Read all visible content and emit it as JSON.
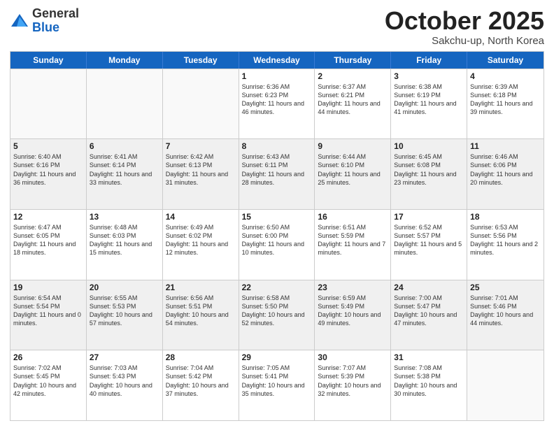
{
  "header": {
    "logo_general": "General",
    "logo_blue": "Blue",
    "month_title": "October 2025",
    "location": "Sakchu-up, North Korea"
  },
  "days_of_week": [
    "Sunday",
    "Monday",
    "Tuesday",
    "Wednesday",
    "Thursday",
    "Friday",
    "Saturday"
  ],
  "weeks": [
    [
      {
        "day": "",
        "sunrise": "",
        "sunset": "",
        "daylight": "",
        "empty": true
      },
      {
        "day": "",
        "sunrise": "",
        "sunset": "",
        "daylight": "",
        "empty": true
      },
      {
        "day": "",
        "sunrise": "",
        "sunset": "",
        "daylight": "",
        "empty": true
      },
      {
        "day": "1",
        "sunrise": "Sunrise: 6:36 AM",
        "sunset": "Sunset: 6:23 PM",
        "daylight": "Daylight: 11 hours and 46 minutes."
      },
      {
        "day": "2",
        "sunrise": "Sunrise: 6:37 AM",
        "sunset": "Sunset: 6:21 PM",
        "daylight": "Daylight: 11 hours and 44 minutes."
      },
      {
        "day": "3",
        "sunrise": "Sunrise: 6:38 AM",
        "sunset": "Sunset: 6:19 PM",
        "daylight": "Daylight: 11 hours and 41 minutes."
      },
      {
        "day": "4",
        "sunrise": "Sunrise: 6:39 AM",
        "sunset": "Sunset: 6:18 PM",
        "daylight": "Daylight: 11 hours and 39 minutes."
      }
    ],
    [
      {
        "day": "5",
        "sunrise": "Sunrise: 6:40 AM",
        "sunset": "Sunset: 6:16 PM",
        "daylight": "Daylight: 11 hours and 36 minutes."
      },
      {
        "day": "6",
        "sunrise": "Sunrise: 6:41 AM",
        "sunset": "Sunset: 6:14 PM",
        "daylight": "Daylight: 11 hours and 33 minutes."
      },
      {
        "day": "7",
        "sunrise": "Sunrise: 6:42 AM",
        "sunset": "Sunset: 6:13 PM",
        "daylight": "Daylight: 11 hours and 31 minutes."
      },
      {
        "day": "8",
        "sunrise": "Sunrise: 6:43 AM",
        "sunset": "Sunset: 6:11 PM",
        "daylight": "Daylight: 11 hours and 28 minutes."
      },
      {
        "day": "9",
        "sunrise": "Sunrise: 6:44 AM",
        "sunset": "Sunset: 6:10 PM",
        "daylight": "Daylight: 11 hours and 25 minutes."
      },
      {
        "day": "10",
        "sunrise": "Sunrise: 6:45 AM",
        "sunset": "Sunset: 6:08 PM",
        "daylight": "Daylight: 11 hours and 23 minutes."
      },
      {
        "day": "11",
        "sunrise": "Sunrise: 6:46 AM",
        "sunset": "Sunset: 6:06 PM",
        "daylight": "Daylight: 11 hours and 20 minutes."
      }
    ],
    [
      {
        "day": "12",
        "sunrise": "Sunrise: 6:47 AM",
        "sunset": "Sunset: 6:05 PM",
        "daylight": "Daylight: 11 hours and 18 minutes."
      },
      {
        "day": "13",
        "sunrise": "Sunrise: 6:48 AM",
        "sunset": "Sunset: 6:03 PM",
        "daylight": "Daylight: 11 hours and 15 minutes."
      },
      {
        "day": "14",
        "sunrise": "Sunrise: 6:49 AM",
        "sunset": "Sunset: 6:02 PM",
        "daylight": "Daylight: 11 hours and 12 minutes."
      },
      {
        "day": "15",
        "sunrise": "Sunrise: 6:50 AM",
        "sunset": "Sunset: 6:00 PM",
        "daylight": "Daylight: 11 hours and 10 minutes."
      },
      {
        "day": "16",
        "sunrise": "Sunrise: 6:51 AM",
        "sunset": "Sunset: 5:59 PM",
        "daylight": "Daylight: 11 hours and 7 minutes."
      },
      {
        "day": "17",
        "sunrise": "Sunrise: 6:52 AM",
        "sunset": "Sunset: 5:57 PM",
        "daylight": "Daylight: 11 hours and 5 minutes."
      },
      {
        "day": "18",
        "sunrise": "Sunrise: 6:53 AM",
        "sunset": "Sunset: 5:56 PM",
        "daylight": "Daylight: 11 hours and 2 minutes."
      }
    ],
    [
      {
        "day": "19",
        "sunrise": "Sunrise: 6:54 AM",
        "sunset": "Sunset: 5:54 PM",
        "daylight": "Daylight: 11 hours and 0 minutes."
      },
      {
        "day": "20",
        "sunrise": "Sunrise: 6:55 AM",
        "sunset": "Sunset: 5:53 PM",
        "daylight": "Daylight: 10 hours and 57 minutes."
      },
      {
        "day": "21",
        "sunrise": "Sunrise: 6:56 AM",
        "sunset": "Sunset: 5:51 PM",
        "daylight": "Daylight: 10 hours and 54 minutes."
      },
      {
        "day": "22",
        "sunrise": "Sunrise: 6:58 AM",
        "sunset": "Sunset: 5:50 PM",
        "daylight": "Daylight: 10 hours and 52 minutes."
      },
      {
        "day": "23",
        "sunrise": "Sunrise: 6:59 AM",
        "sunset": "Sunset: 5:49 PM",
        "daylight": "Daylight: 10 hours and 49 minutes."
      },
      {
        "day": "24",
        "sunrise": "Sunrise: 7:00 AM",
        "sunset": "Sunset: 5:47 PM",
        "daylight": "Daylight: 10 hours and 47 minutes."
      },
      {
        "day": "25",
        "sunrise": "Sunrise: 7:01 AM",
        "sunset": "Sunset: 5:46 PM",
        "daylight": "Daylight: 10 hours and 44 minutes."
      }
    ],
    [
      {
        "day": "26",
        "sunrise": "Sunrise: 7:02 AM",
        "sunset": "Sunset: 5:45 PM",
        "daylight": "Daylight: 10 hours and 42 minutes."
      },
      {
        "day": "27",
        "sunrise": "Sunrise: 7:03 AM",
        "sunset": "Sunset: 5:43 PM",
        "daylight": "Daylight: 10 hours and 40 minutes."
      },
      {
        "day": "28",
        "sunrise": "Sunrise: 7:04 AM",
        "sunset": "Sunset: 5:42 PM",
        "daylight": "Daylight: 10 hours and 37 minutes."
      },
      {
        "day": "29",
        "sunrise": "Sunrise: 7:05 AM",
        "sunset": "Sunset: 5:41 PM",
        "daylight": "Daylight: 10 hours and 35 minutes."
      },
      {
        "day": "30",
        "sunrise": "Sunrise: 7:07 AM",
        "sunset": "Sunset: 5:39 PM",
        "daylight": "Daylight: 10 hours and 32 minutes."
      },
      {
        "day": "31",
        "sunrise": "Sunrise: 7:08 AM",
        "sunset": "Sunset: 5:38 PM",
        "daylight": "Daylight: 10 hours and 30 minutes."
      },
      {
        "day": "",
        "sunrise": "",
        "sunset": "",
        "daylight": "",
        "empty": true
      }
    ]
  ]
}
